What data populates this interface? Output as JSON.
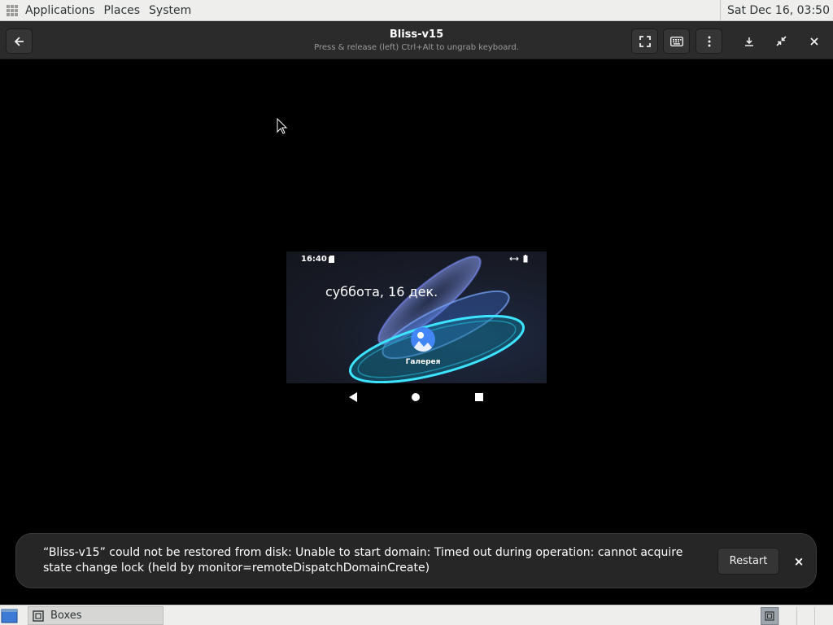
{
  "top_panel": {
    "menus": [
      "Applications",
      "Places",
      "System"
    ],
    "clock": "Sat Dec 16, 03:50"
  },
  "header": {
    "title": "Bliss-v15",
    "subtitle": "Press & release (left) Ctrl+Alt to ungrab keyboard.",
    "icons": [
      "back-arrow-icon",
      "fullscreen-icon",
      "keyboard-icon",
      "vertical-dots-icon",
      "download-icon",
      "restore-icon",
      "close-icon"
    ]
  },
  "vm": {
    "status_time": "16:40",
    "date": "суббота, 16 дек.",
    "app_label": "Галерея"
  },
  "toast": {
    "message": "“Bliss-v15” could not be restored from disk: Unable to start domain: Timed out during operation: cannot acquire state change lock (held by monitor=remoteDispatchDomainCreate)",
    "restart_label": "Restart",
    "close_label": "×"
  },
  "taskbar": {
    "task_label": "Boxes"
  },
  "colors": {
    "header_bg": "#2b2b2b",
    "toast_bg": "#262626",
    "panel_bg": "#eeeeec",
    "accent_blue": "#4285f4"
  }
}
